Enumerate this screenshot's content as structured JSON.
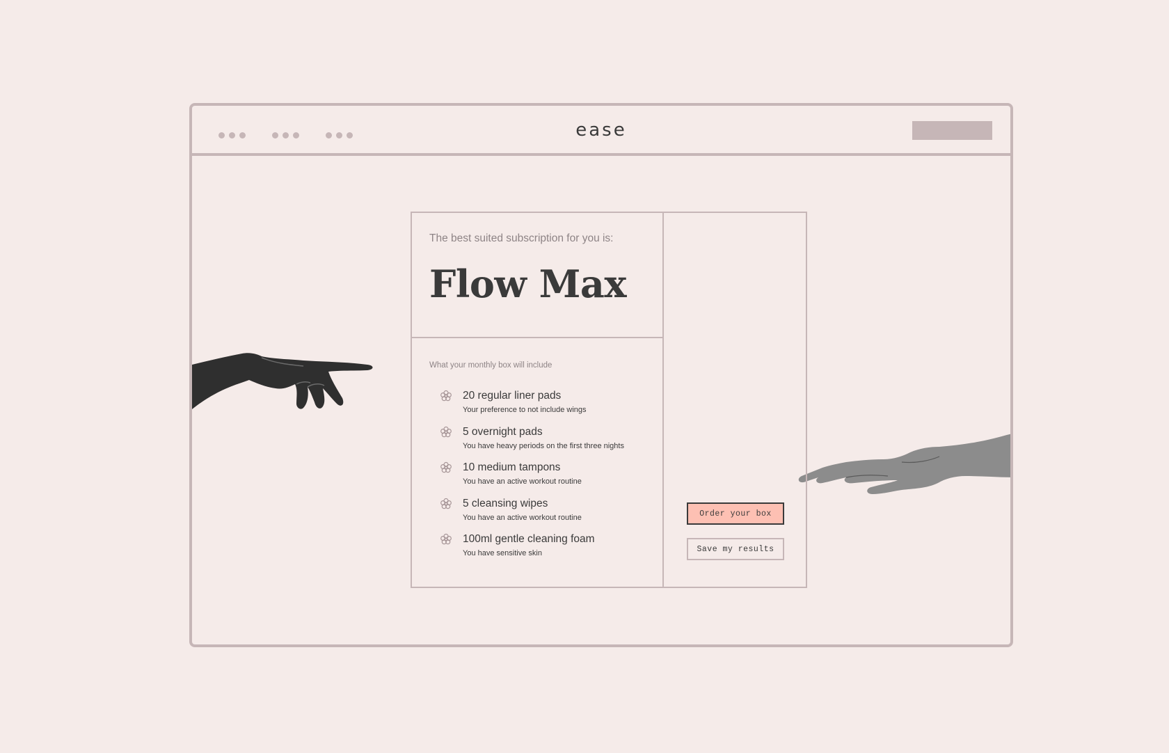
{
  "header": {
    "logo": "ease",
    "nav_groups": [
      "nav-group-1",
      "nav-group-2",
      "nav-group-3"
    ]
  },
  "result": {
    "subtitle": "The best suited subscription for you is:",
    "plan_name": "Flow Max"
  },
  "contents": {
    "heading": "What your monthly box will include",
    "items": [
      {
        "title": "20 regular liner pads",
        "reason": "Your preference to not include wings"
      },
      {
        "title": "5 overnight pads",
        "reason": "You have heavy periods on the first three nights"
      },
      {
        "title": "10 medium tampons",
        "reason": "You have an active workout routine"
      },
      {
        "title": "5 cleansing wipes",
        "reason": "You have an active workout routine"
      },
      {
        "title": "100ml gentle cleaning foam",
        "reason": "You have sensitive skin"
      }
    ],
    "item_icon": "flower-icon"
  },
  "actions": {
    "order_label": "Order your box",
    "save_label": "Save my results"
  },
  "colors": {
    "background": "#f5ebe9",
    "frame": "#c6b6b7",
    "text": "#3a3a3a",
    "muted_text": "#8e8486",
    "accent": "#fdc0b3"
  },
  "decorations": {
    "left_image": "pointing-hand-left",
    "right_image": "reaching-hand-right"
  }
}
